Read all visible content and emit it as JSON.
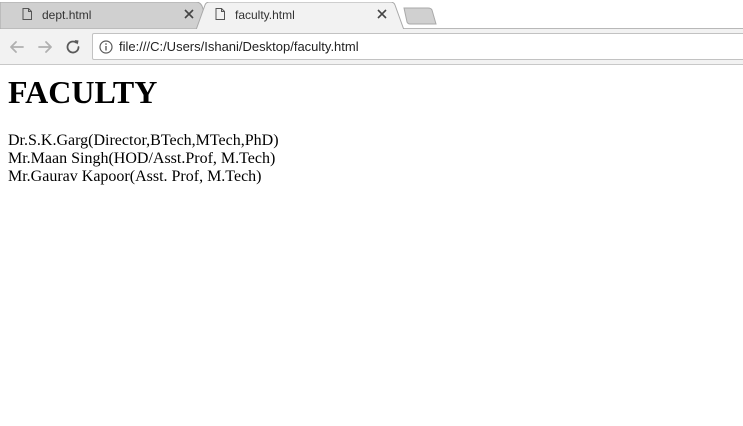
{
  "tabs": [
    {
      "title": "dept.html",
      "active": false
    },
    {
      "title": "faculty.html",
      "active": true
    }
  ],
  "address_bar": {
    "url": "file:///C:/Users/Ishani/Desktop/faculty.html"
  },
  "page": {
    "heading": "FACULTY",
    "faculty": [
      "Dr.S.K.Garg(Director,BTech,MTech,PhD)",
      "Mr.Maan Singh(HOD/Asst.Prof, M.Tech)",
      "Mr.Gaurav Kapoor(Asst. Prof, M.Tech)"
    ]
  },
  "icons": {
    "tab_page": "document-icon",
    "tab_close": "close-icon",
    "back": "arrow-left-icon",
    "forward": "arrow-right-icon",
    "reload": "reload-icon",
    "site_info": "info-icon"
  },
  "colors": {
    "inactive_tab": "#d0d0d0",
    "active_tab": "#f2f2f2",
    "toolbar": "#f2f2f2",
    "nav_icon_disabled": "#b0b0b0",
    "nav_icon_enabled": "#5a5a5a"
  }
}
